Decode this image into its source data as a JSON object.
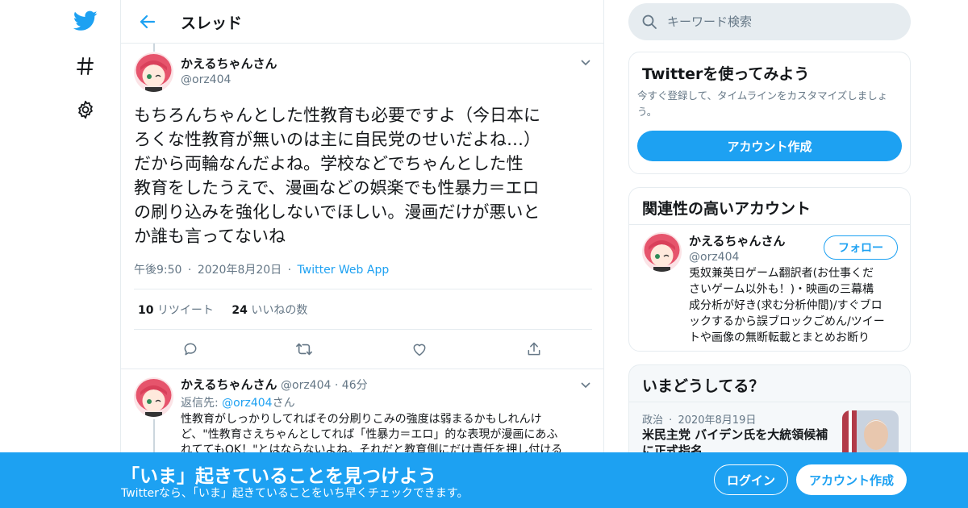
{
  "nav": {
    "icons": [
      "twitter-logo-icon",
      "hashtag-icon",
      "gear-icon"
    ]
  },
  "header": {
    "title": "スレッド"
  },
  "tweet": {
    "name": "かえるちゃんさん",
    "handle": "@orz404",
    "lines": [
      "もちろんちゃんとした性教育も必要ですよ（今日本に",
      "ろくな性教育が無いのは主に自民党のせいだよね…）",
      "だから両輪なんだよね。学校などでちゃんとした性",
      "教育をしたうえで、漫画などの娯楽でも性暴力＝エロ",
      "の刷り込みを強化しないでほしい。漫画だけが悪いと",
      "か誰も言ってないね"
    ],
    "time": "午後9:50",
    "date": "2020年8月20日",
    "source": "Twitter Web App",
    "retweet_count": "10",
    "retweet_label": "リツイート",
    "like_count": "24",
    "like_label": "いいねの数"
  },
  "reply": {
    "name": "かえるちゃんさん",
    "handle": "@orz404",
    "age": "46分",
    "replying_prefix": "返信先: ",
    "replying_to": "@orz404",
    "replying_suffix": "さん",
    "lines": [
      "性教育がしっかりしてればその分刷りこみの強度は弱まるかもしれんけ",
      "ど、\"性教育さえちゃんとしてれば「性暴力＝エロ」的な表現が漫画にあふ",
      "れててもOK！\"とはならないよね。それだと教育側にだけ責任を押し付ける"
    ]
  },
  "search": {
    "placeholder": "キーワード検索"
  },
  "signup_card": {
    "title": "Twitterを使ってみよう",
    "desc": "今すぐ登録して、タイムラインをカスタマイズしましょう。",
    "button": "アカウント作成"
  },
  "related_card": {
    "title": "関連性の高いアカウント",
    "name": "かえるちゃんさん",
    "handle": "@orz404",
    "follow": "フォロー",
    "bio": [
      "兎奴兼英日ゲーム翻訳者(お仕事くだ",
      "さいゲーム以外も！)・映画の三幕構",
      "成分析が好き(求む分析仲間)/すぐブロ",
      "ックするから誤ブロックごめん/ツイー",
      "トや画像の無断転載とまとめお断り"
    ]
  },
  "trends_card": {
    "title": "いまどうしてる？",
    "category": "政治",
    "date": "2020年8月19日",
    "headline_1": "米民主党 バイデン氏を大統領候補",
    "headline_2": "に正式指名"
  },
  "banner": {
    "title": "「いま」起きていることを見つけよう",
    "sub": "Twitterなら、「いま」起きていることをいち早くチェックできます。",
    "login": "ログイン",
    "signup": "アカウント作成"
  },
  "colors": {
    "accent": "#1da1f2",
    "border": "#e6ecf0",
    "muted": "#657786"
  }
}
